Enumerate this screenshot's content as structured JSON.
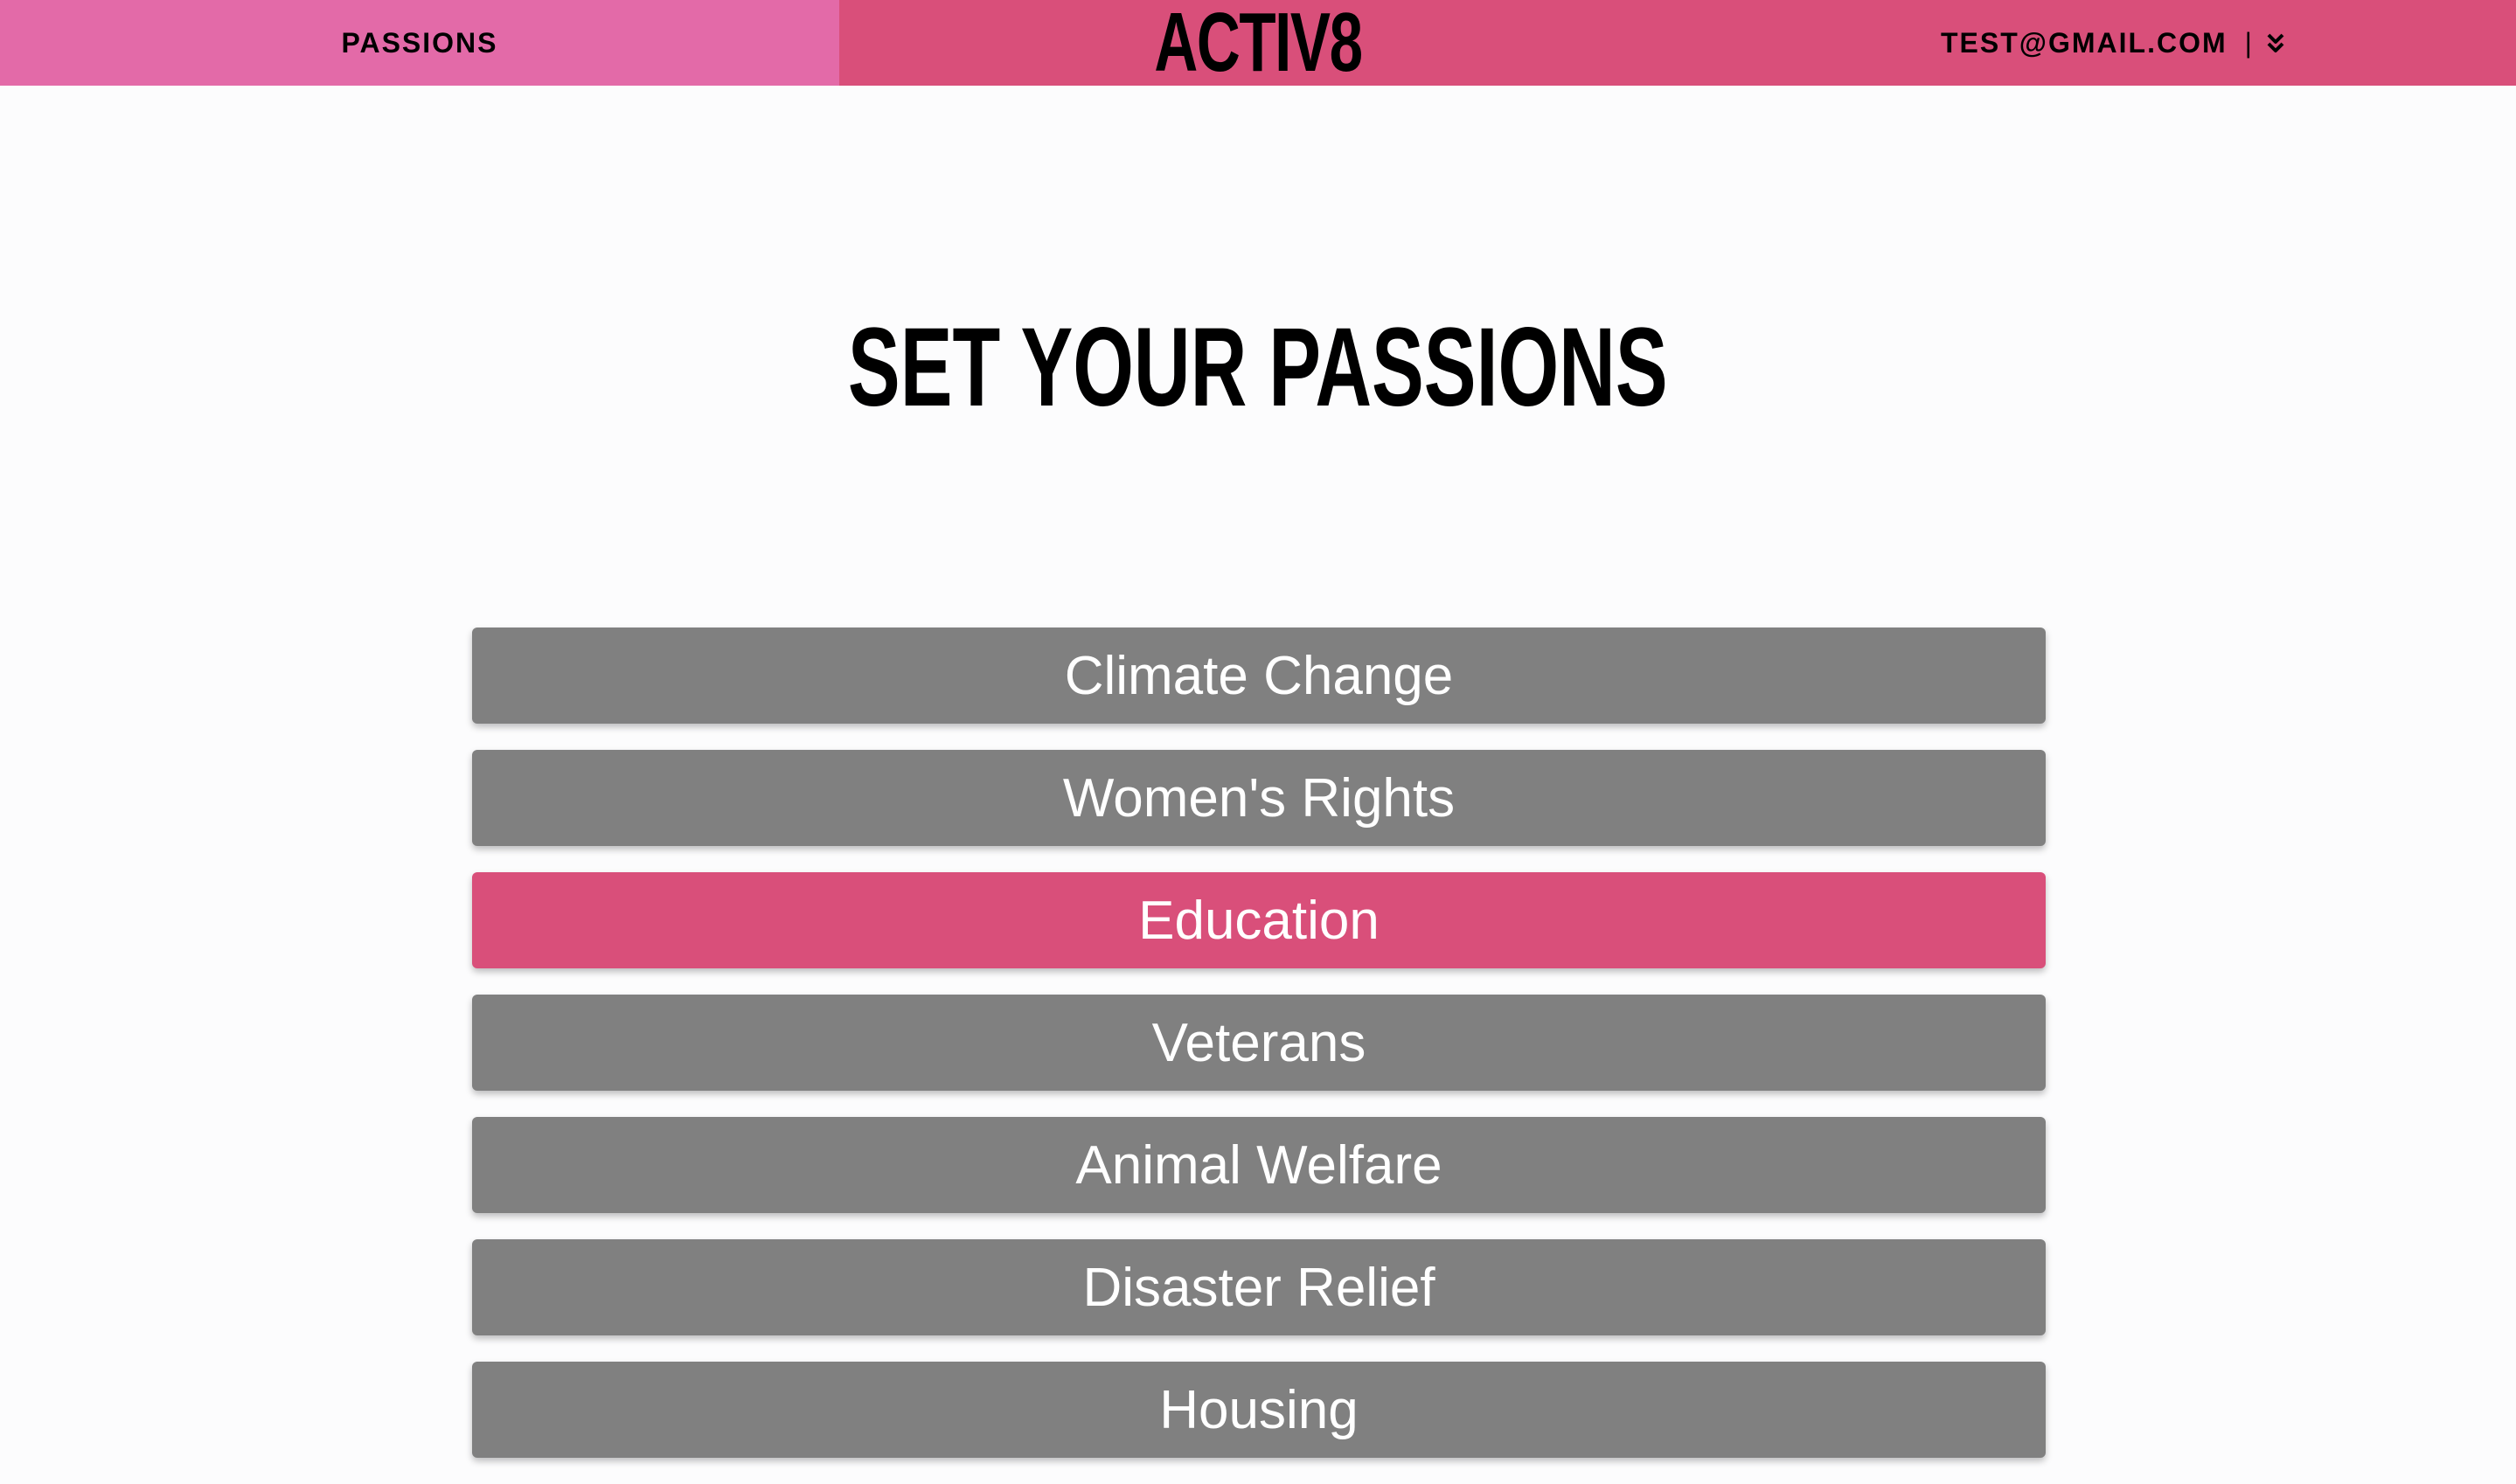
{
  "nav": {
    "tab_label": "PASSIONS",
    "brand": "ACTIV8",
    "user_email": "TEST@GMAIL.COM",
    "separator": "|",
    "menu_icon": "double-chevron-down-icon"
  },
  "page": {
    "title": "SET YOUR PASSIONS"
  },
  "passions": [
    {
      "label": "Climate Change",
      "selected": false
    },
    {
      "label": "Women's Rights",
      "selected": false
    },
    {
      "label": "Education",
      "selected": true
    },
    {
      "label": "Veterans",
      "selected": false
    },
    {
      "label": "Animal Welfare",
      "selected": false
    },
    {
      "label": "Disaster Relief",
      "selected": false
    },
    {
      "label": "Housing",
      "selected": false
    }
  ],
  "colors": {
    "nav_bar": "#d94f7a",
    "nav_tab": "#e36aa8",
    "selected": "#d94f7a",
    "unselected": "#808080",
    "background": "#fcfcfd"
  }
}
